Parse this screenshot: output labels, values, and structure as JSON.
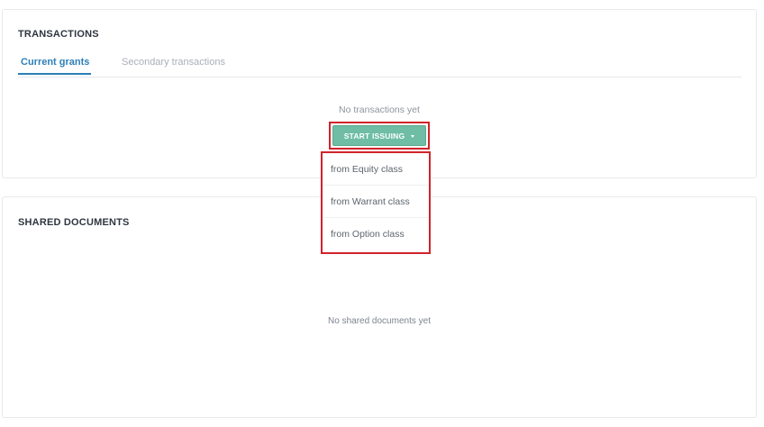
{
  "transactions": {
    "title": "TRANSACTIONS",
    "tabs": [
      {
        "label": "Current grants",
        "active": true
      },
      {
        "label": "Secondary transactions",
        "active": false
      }
    ],
    "empty_text": "No transactions yet",
    "start_button": {
      "label": "START ISSUING",
      "color": "#6ebda4"
    },
    "dropdown_items": [
      {
        "label": "from Equity class"
      },
      {
        "label": "from Warrant class"
      },
      {
        "label": "from Option class"
      }
    ]
  },
  "shared_documents": {
    "title": "SHARED DOCUMENTS",
    "empty_text": "No shared documents yet"
  },
  "colors": {
    "accent": "#2c7fb8",
    "button": "#6ebda4",
    "highlight": "#d0232b"
  }
}
